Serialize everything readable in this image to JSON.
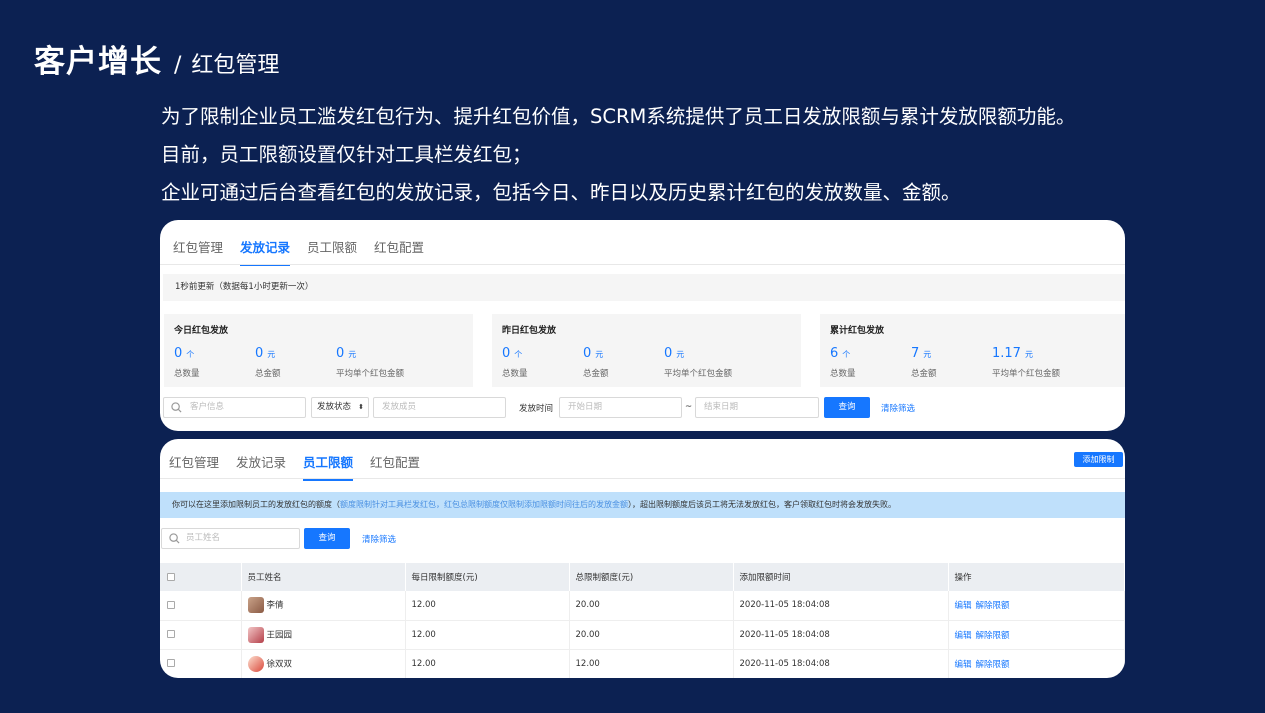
{
  "header": {
    "title": "客户增长",
    "separator": "/",
    "subtitle": "红包管理"
  },
  "intro": {
    "lines": [
      "为了限制企业员工滥发红包行为、提升红包价值，SCRM系统提供了员工日发放限额与累计发放限额功能。",
      "目前，员工限额设置仅针对工具栏发红包；",
      "企业可通过后台查看红包的发放记录，包括今日、昨日以及历史累计红包的发放数量、金额。"
    ]
  },
  "card1": {
    "tabs": [
      "红包管理",
      "发放记录",
      "员工限额",
      "红包配置"
    ],
    "update_text": "1秒前更新（数据每1小时更新一次）",
    "stats": [
      {
        "title": "今日红包发放",
        "count": "0",
        "count_unit": "个",
        "amount": "0",
        "amount_unit": "元",
        "avg": "0",
        "avg_unit": "元"
      },
      {
        "title": "昨日红包发放",
        "count": "0",
        "count_unit": "个",
        "amount": "0",
        "amount_unit": "元",
        "avg": "0",
        "avg_unit": "元"
      },
      {
        "title": "累计红包发放",
        "count": "6",
        "count_unit": "个",
        "amount": "7",
        "amount_unit": "元",
        "avg": "1.17",
        "avg_unit": "元"
      }
    ],
    "stat_labels": {
      "count": "总数量",
      "amount": "总金额",
      "avg": "平均单个红包金额"
    },
    "filters": {
      "customer_placeholder": "客户信息",
      "status_label": "发放状态",
      "result_placeholder": "发放成员",
      "time_label": "发放时间",
      "start_placeholder": "开始日期",
      "range_sep": "~",
      "end_placeholder": "结束日期",
      "query": "查询",
      "clear": "清除筛选"
    }
  },
  "card2": {
    "tabs": [
      "红包管理",
      "发放记录",
      "员工限额",
      "红包配置"
    ],
    "add_button": "添加限制",
    "notice_pre": "你可以在这里添加限制员工的发放红包的额度（",
    "notice_hl": "额度限制针对工具栏发红包，红包总限制额度仅限制添加限额时间往后的发放金额",
    "notice_post": "），超出限制额度后该员工将无法发放红包，客户领取红包时将会发放失败。",
    "search_placeholder": "员工姓名",
    "query": "查询",
    "clear": "清除筛选",
    "columns": [
      "员工姓名",
      "每日限制额度(元)",
      "总限制额度(元)",
      "添加限额时间",
      "操作"
    ],
    "rows": [
      {
        "name": "李倩",
        "daily": "12.00",
        "total": "20.00",
        "time": "2020-11-05 18:04:08",
        "edit": "编辑",
        "remove": "解除限额"
      },
      {
        "name": "王园园",
        "daily": "12.00",
        "total": "20.00",
        "time": "2020-11-05 18:04:08",
        "edit": "编辑",
        "remove": "解除限额"
      },
      {
        "name": "徐双双",
        "daily": "12.00",
        "total": "12.00",
        "time": "2020-11-05 18:04:08",
        "edit": "编辑",
        "remove": "解除限额"
      }
    ]
  }
}
